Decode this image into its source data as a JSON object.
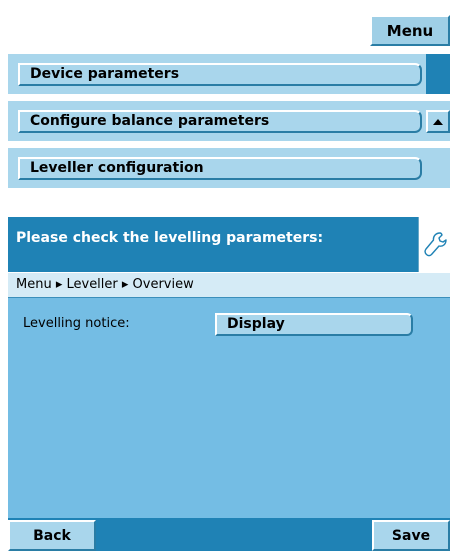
{
  "top_menu": {
    "label": "Menu"
  },
  "menu_items": [
    {
      "label": "Device parameters"
    },
    {
      "label": "Configure balance parameters"
    },
    {
      "label": "Leveller configuration"
    }
  ],
  "panel": {
    "header_title": "Please check the levelling parameters:",
    "breadcrumb": "Menu ▸ Leveller ▸ Overview",
    "notice_label": "Levelling notice:",
    "notice_value": "Display"
  },
  "softkeys": {
    "back": "Back",
    "save": "Save"
  },
  "icons": {
    "header_icon": "wrench-icon",
    "scroll_icon": "arrow-up-icon"
  },
  "colors": {
    "header_blue": "#1f82b5",
    "panel_blue": "#74bde4",
    "button_light": "#a9d6ec"
  }
}
